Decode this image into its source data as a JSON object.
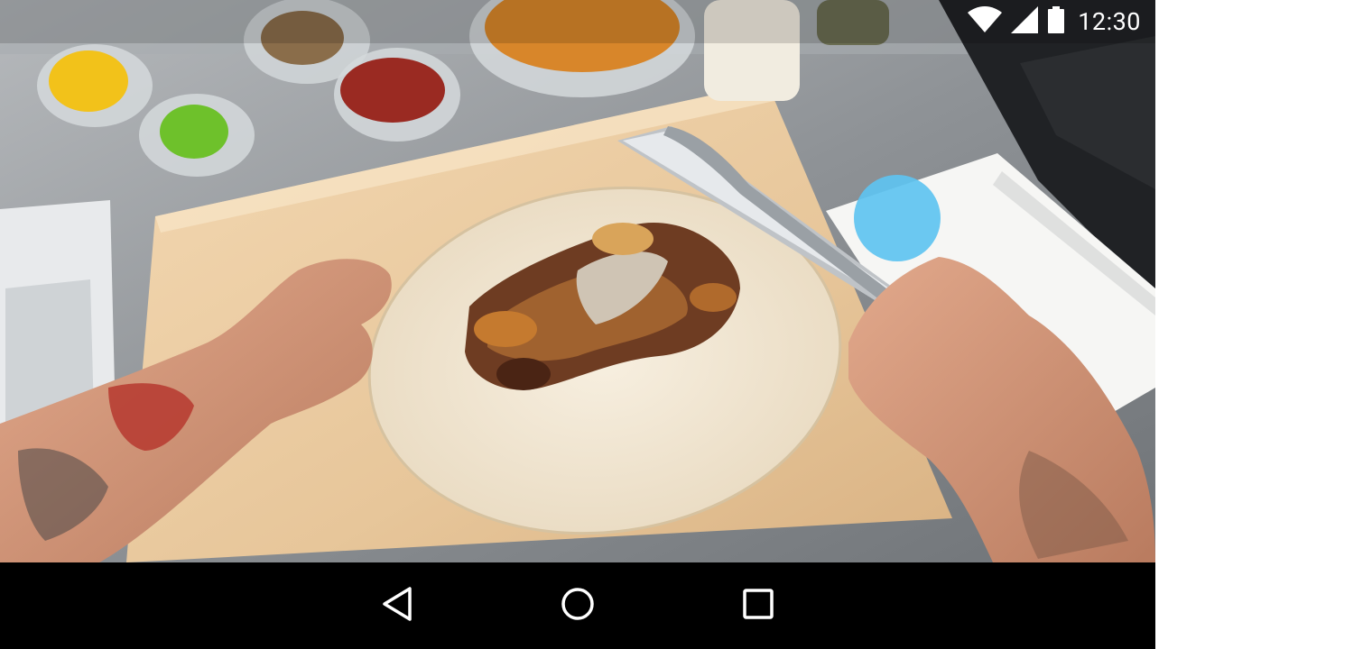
{
  "status_bar": {
    "time": "12:30",
    "icons": [
      "wifi-icon",
      "cell-signal-icon",
      "battery-icon"
    ]
  },
  "video": {
    "scene": "cooking-video-frame"
  },
  "nav_bar": {
    "buttons": [
      "back-icon",
      "home-icon",
      "recents-icon"
    ]
  },
  "colors": {
    "touch_indicator": "#5ec3f0",
    "nav_bar_bg": "#000000",
    "status_text": "#ffffff"
  }
}
